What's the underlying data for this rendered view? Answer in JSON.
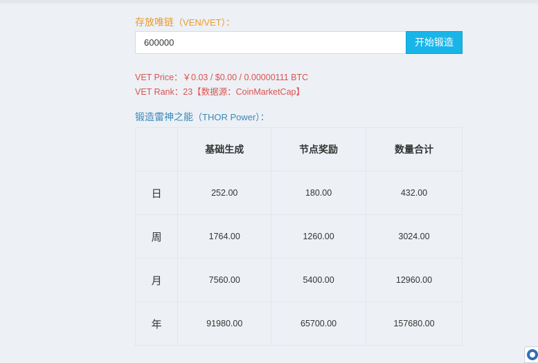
{
  "stake": {
    "label": "存放唯链",
    "label_sub": "（VEN/VET）：",
    "amount_value": "600000",
    "button_label": "开始锻造"
  },
  "price": {
    "price_line": "VET Price：￥0.03 / $0.00 / 0.00000111 BTC",
    "rank_line": "VET Rank：23【数据源：CoinMarketCap】"
  },
  "power": {
    "label": "锻造雷神之能",
    "label_sub": "（THOR Power）："
  },
  "table": {
    "headers": [
      "",
      "基础生成",
      "节点奖励",
      "数量合计"
    ],
    "rows": [
      {
        "period": "日",
        "base": "252.00",
        "node": "180.00",
        "total": "432.00"
      },
      {
        "period": "周",
        "base": "1764.00",
        "node": "1260.00",
        "total": "3024.00"
      },
      {
        "period": "月",
        "base": "7560.00",
        "node": "5400.00",
        "total": "12960.00"
      },
      {
        "period": "年",
        "base": "91980.00",
        "node": "65700.00",
        "total": "157680.00"
      }
    ]
  },
  "colors": {
    "accent_orange": "#ed9a27",
    "accent_blue": "#3a88b8",
    "button": "#19b5e9",
    "price_red": "#d9534f"
  }
}
